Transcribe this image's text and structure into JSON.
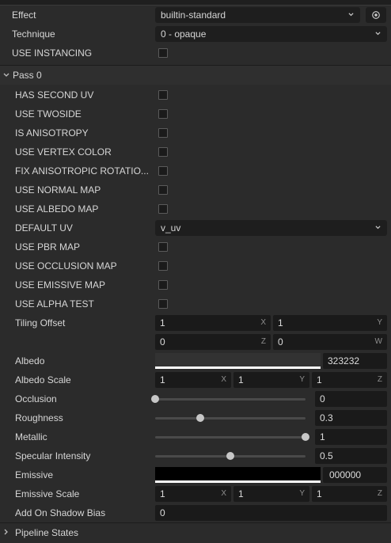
{
  "effect": {
    "label": "Effect",
    "value": "builtin-standard",
    "locate_icon": "target-icon"
  },
  "technique": {
    "label": "Technique",
    "value": "0 - opaque"
  },
  "use_instancing": {
    "label": "USE INSTANCING"
  },
  "pass": {
    "label": "Pass 0"
  },
  "defines": [
    "HAS SECOND UV",
    "USE TWOSIDE",
    "IS ANISOTROPY",
    "USE VERTEX COLOR",
    "FIX ANISOTROPIC ROTATIO...",
    "USE NORMAL MAP",
    "USE ALBEDO MAP"
  ],
  "default_uv": {
    "label": "DEFAULT UV",
    "value": "v_uv"
  },
  "defines2": [
    "USE PBR MAP",
    "USE OCCLUSION MAP",
    "USE EMISSIVE MAP",
    "USE ALPHA TEST"
  ],
  "tiling_offset": {
    "label": "Tiling Offset",
    "x": "1",
    "y": "1",
    "z": "0",
    "w": "0",
    "axes": [
      "X",
      "Y",
      "Z",
      "W"
    ]
  },
  "albedo": {
    "label": "Albedo",
    "hex": "323232",
    "color": "#323232"
  },
  "albedo_scale": {
    "label": "Albedo Scale",
    "x": "1",
    "y": "1",
    "z": "1",
    "axes": [
      "X",
      "Y",
      "Z"
    ]
  },
  "occlusion": {
    "label": "Occlusion",
    "value": "0",
    "fraction": 0
  },
  "roughness": {
    "label": "Roughness",
    "value": "0.3",
    "fraction": 0.3
  },
  "metallic": {
    "label": "Metallic",
    "value": "1",
    "fraction": 1
  },
  "specular_intensity": {
    "label": "Specular Intensity",
    "value": "0.5",
    "fraction": 0.5
  },
  "emissive": {
    "label": "Emissive",
    "hex": "000000",
    "color": "#000000"
  },
  "emissive_scale": {
    "label": "Emissive Scale",
    "x": "1",
    "y": "1",
    "z": "1",
    "axes": [
      "X",
      "Y",
      "Z"
    ]
  },
  "shadow_bias": {
    "label": "Add On Shadow Bias",
    "value": "0"
  },
  "pipeline": {
    "label": "Pipeline States"
  }
}
